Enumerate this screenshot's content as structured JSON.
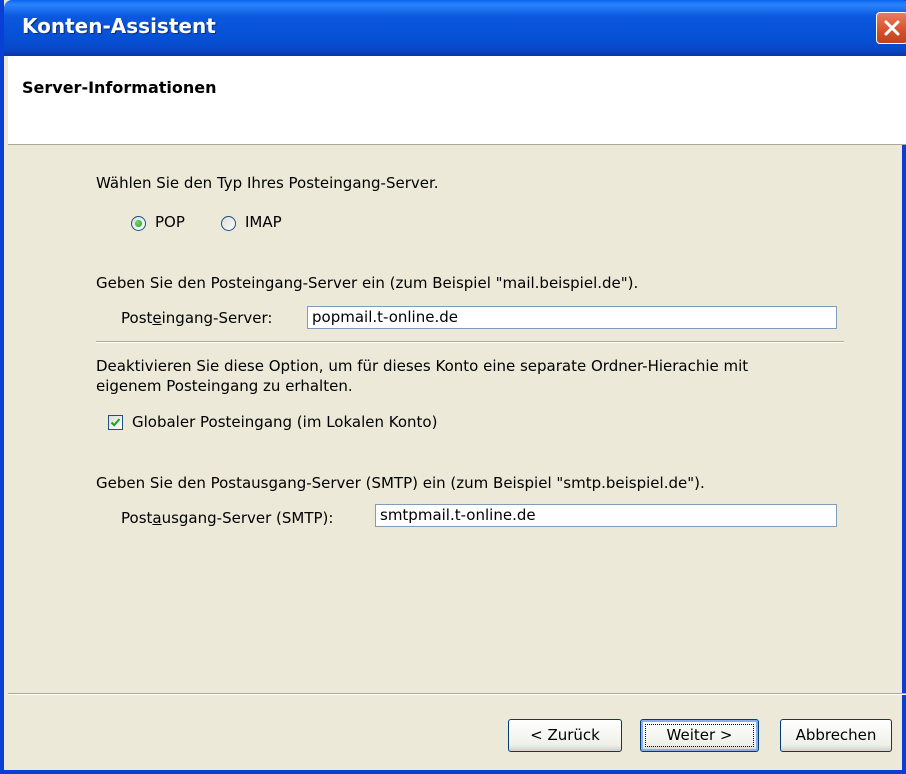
{
  "window": {
    "title": "Konten-Assistent"
  },
  "header": {
    "title": "Server-Informationen"
  },
  "incoming_type": {
    "prompt": "Wählen Sie den Typ Ihres Posteingang-Server.",
    "options": [
      "POP",
      "IMAP"
    ],
    "selected": "POP"
  },
  "incoming_server": {
    "prompt": "Geben Sie den Posteingang-Server ein (zum Beispiel \"mail.beispiel.de\").",
    "label_pre": "Post",
    "label_u": "e",
    "label_post": "ingang-Server:",
    "value": "popmail.t-online.de"
  },
  "global_inbox": {
    "prompt_line1": "Deaktivieren Sie diese Option, um für dieses Konto eine separate Ordner-Hierachie mit",
    "prompt_line2": "eigenem Posteingang zu erhalten.",
    "checkbox_label": "Globaler Posteingang (im Lokalen Konto)",
    "checked": true
  },
  "outgoing_server": {
    "prompt": "Geben Sie den Postausgang-Server (SMTP) ein (zum Beispiel \"smtp.beispiel.de\").",
    "label_pre": "Post",
    "label_u": "a",
    "label_post": "usgang-Server (SMTP):",
    "value": "smtpmail.t-online.de"
  },
  "buttons": {
    "back": "< Zurück",
    "next": "Weiter >",
    "cancel": "Abbrechen"
  },
  "colors": {
    "titlebar": "#0550d4",
    "dialog_bg": "#ece9d8",
    "close_button": "#d4512c"
  }
}
